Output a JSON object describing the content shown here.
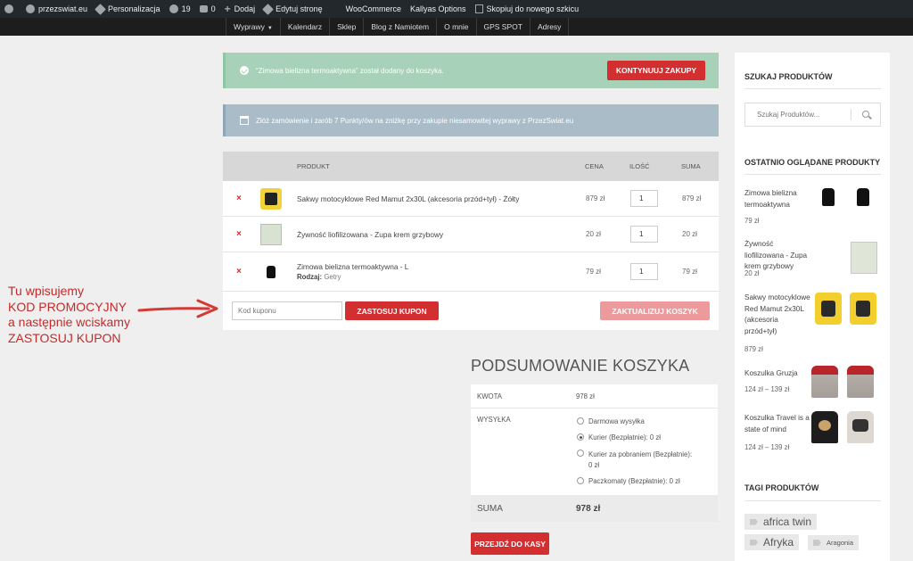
{
  "admin_bar": {
    "site_name": "przezswiat.eu",
    "personalize": "Personalizacja",
    "updates_count": "19",
    "comments_count": "0",
    "add_new": "Dodaj",
    "edit_page": "Edytuj stronę",
    "woocommerce": "WooCommerce",
    "kallyas": "Kallyas Options",
    "copy_draft": "Skopiuj do nowego szkicu"
  },
  "nav": {
    "items": [
      "Wyprawy",
      "Kalendarz",
      "Sklep",
      "Blog z Namiotem",
      "O mnie",
      "GPS SPOT",
      "Adresy"
    ]
  },
  "notices": {
    "added": "“Zimowa bielizna termoaktywna” został dodany do koszyka.",
    "continue_button": "KONTYNUUJ ZAKUPY",
    "points": "Złóż zamówienie i zarób 7 Punkty/ów na zniżkę przy zakupie niesamowitej wyprawy z PrzezSwiat.eu"
  },
  "cart": {
    "headers": {
      "product": "PRODUKT",
      "price": "CENA",
      "quantity": "ILOŚĆ",
      "total": "SUMA"
    },
    "remove_symbol": "×",
    "rows": [
      {
        "name": "Sakwy motocyklowe Red Mamut 2x30L (akcesoria przód+tył) - Żółty",
        "price": "879 zł",
        "qty": "1",
        "total": "879 zł"
      },
      {
        "name": "Żywność liofilizowana - Zupa krem grzybowy",
        "price": "20 zł",
        "qty": "1",
        "total": "20 zł"
      },
      {
        "name": "Zimowa bielizna termoaktywna - L",
        "variant_label": "Rodzaj:",
        "variant_value": "Getry",
        "price": "79 zł",
        "qty": "1",
        "total": "79 zł"
      }
    ],
    "coupon_placeholder": "Kod kuponu",
    "apply_coupon": "ZASTOSUJ KUPON",
    "update_cart": "ZAKTUALIZUJ KOSZYK"
  },
  "annotation": {
    "lines": [
      "Tu wpisujemy",
      "KOD PROMOCYJNY",
      "a następnie wciskamy",
      "ZASTOSUJ KUPON"
    ],
    "color": "#c42a2a"
  },
  "totals": {
    "title": "PODSUMOWANIE KOSZYKA",
    "amount_label": "KWOTA",
    "amount_value": "978 zł",
    "shipping_label": "WYSYŁKA",
    "shipping_options": [
      {
        "label": "Darmowa wysyłka",
        "selected": false
      },
      {
        "label": "Kurier (Bezpłatnie): 0 zł",
        "selected": true
      },
      {
        "label": "Kurier za pobraniem (Bezpłatnie):",
        "label2": "0 zł",
        "selected": false
      },
      {
        "label": "Paczkomaty (Bezpłatnie): 0 zł",
        "selected": false
      }
    ],
    "sum_label": "SUMA",
    "sum_value": "978 zł",
    "checkout_button": "PRZEJDŹ DO KASY"
  },
  "sidebar": {
    "search_title": "SZUKAJ PRODUKTÓW",
    "search_placeholder": "Szukaj Produktów...",
    "recent_title": "OSTATNIO OGLĄDANE PRODUKTY",
    "recent": [
      {
        "name": "Zimowa bielizna termoaktywna",
        "price": "79 zł"
      },
      {
        "name": "Żywność liofilizowana - Zupa krem grzybowy",
        "price": "20 zł"
      },
      {
        "name": "Sakwy motocyklowe Red Mamut 2x30L (akcesoria przód+tył)",
        "price": "879 zł"
      },
      {
        "name": "Koszulka Gruzja",
        "price": "124 zł – 139 zł"
      },
      {
        "name": "Koszulka Travel is a state of mind",
        "price": "124 zł – 139 zł"
      }
    ],
    "tags_title": "TAGI PRODUKTÓW",
    "tags": [
      "africa twin",
      "Afryka",
      "Aragonia"
    ]
  },
  "colors": {
    "accent": "#d32e30",
    "success": "#a7d1b9",
    "info": "#a9bcc8",
    "admin_bar": "#23282d"
  }
}
